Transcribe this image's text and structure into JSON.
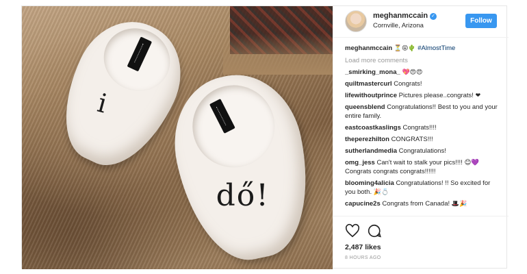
{
  "post": {
    "username": "meghanmccain",
    "location": "Cornville, Arizona",
    "follow_label": "Follow",
    "photo": {
      "left_slipper_text": "i",
      "right_slipper_text": "dő!"
    },
    "caption": {
      "user": "meghanmccain",
      "emoji": "⏳😝🌵",
      "hashtag": "#AlmostTime"
    },
    "load_more_label": "Load more comments",
    "comments": [
      {
        "user": "_smirking_mona_",
        "text": "",
        "emoji": "💖😍😍"
      },
      {
        "user": "quiltmastercurl",
        "text": "Congrats!",
        "emoji": ""
      },
      {
        "user": "lifewithoutprince",
        "text": "Pictures please..congrats!",
        "emoji": "❤"
      },
      {
        "user": "queensblend",
        "text": "Congratulations!! Best to you and your entire family.",
        "emoji": ""
      },
      {
        "user": "eastcoastkaslings",
        "text": "Congrats!!!!",
        "emoji": ""
      },
      {
        "user": "theperezhilton",
        "text": "CONGRATS!!!",
        "emoji": ""
      },
      {
        "user": "sutherlandmedia",
        "text": "Congratulations!",
        "emoji": ""
      },
      {
        "user": "omg_jess",
        "text": "Can't wait to stalk your pics!!!! 😊💜Congrats congrats congrats!!!!!!",
        "emoji": ""
      },
      {
        "user": "blooming4alicia",
        "text": "Congratulations! !! So excited for you both.",
        "emoji": "🎉💍"
      },
      {
        "user": "capucine2s",
        "text": "Congrats from Canada!",
        "emoji": "🎩🎉"
      }
    ],
    "likes": "2,487 likes",
    "time": "8 HOURS AGO",
    "colors": {
      "accent": "#3897f0",
      "verified": "#3897f0",
      "muted": "#999999"
    }
  }
}
